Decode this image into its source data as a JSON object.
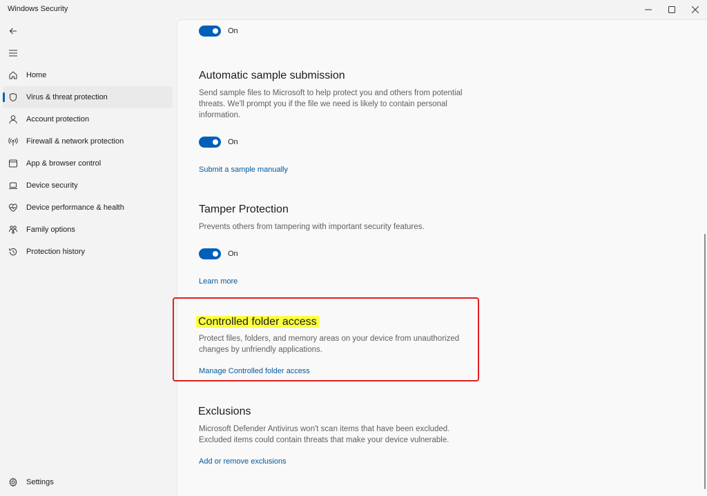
{
  "window": {
    "title": "Windows Security",
    "controls": {
      "minimize": "—",
      "maximize": "☐",
      "close": "✕"
    }
  },
  "sidebar": {
    "back_icon": "back-arrow-icon",
    "menu_icon": "hamburger-icon",
    "items": [
      {
        "label": "Home",
        "icon": "home-icon",
        "selected": false
      },
      {
        "label": "Virus & threat protection",
        "icon": "shield-icon",
        "selected": true
      },
      {
        "label": "Account protection",
        "icon": "person-icon",
        "selected": false
      },
      {
        "label": "Firewall & network protection",
        "icon": "antenna-icon",
        "selected": false
      },
      {
        "label": "App & browser control",
        "icon": "app-window-icon",
        "selected": false
      },
      {
        "label": "Device security",
        "icon": "laptop-icon",
        "selected": false
      },
      {
        "label": "Device performance & health",
        "icon": "heart-pulse-icon",
        "selected": false
      },
      {
        "label": "Family options",
        "icon": "family-icon",
        "selected": false
      },
      {
        "label": "Protection history",
        "icon": "history-icon",
        "selected": false
      }
    ],
    "settings": {
      "label": "Settings",
      "icon": "gear-icon"
    }
  },
  "content": {
    "top_toggle": {
      "state": "On"
    },
    "automatic_sample": {
      "title": "Automatic sample submission",
      "description": "Send sample files to Microsoft to help protect you and others from potential threats. We'll prompt you if the file we need is likely to contain personal information.",
      "toggle_state": "On",
      "link": "Submit a sample manually"
    },
    "tamper": {
      "title": "Tamper Protection",
      "description": "Prevents others from tampering with important security features.",
      "toggle_state": "On",
      "link": "Learn more"
    },
    "controlled_folder": {
      "title": "Controlled folder access",
      "description": "Protect files, folders, and memory areas on your device from unauthorized changes by unfriendly applications.",
      "link": "Manage Controlled folder access",
      "annotation_colors": {
        "box": "#e01d1d",
        "highlight": "#fbff3e"
      }
    },
    "exclusions": {
      "title": "Exclusions",
      "description": "Microsoft Defender Antivirus won't scan items that have been excluded. Excluded items could contain threats that make your device vulnerable.",
      "link": "Add or remove exclusions"
    }
  },
  "colors": {
    "accent": "#005fb8",
    "link": "#00599c"
  }
}
